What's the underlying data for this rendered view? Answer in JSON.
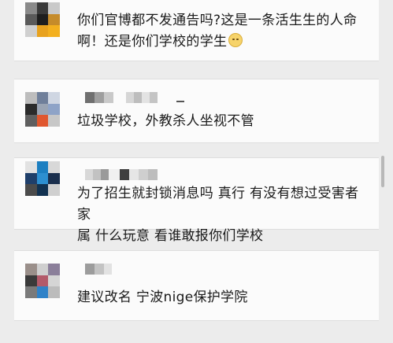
{
  "comments": [
    {
      "text_line1": "你们官博都不发通告吗?这是一条活生生的人命",
      "text_line2": "啊！还是你们学校的学生",
      "emoji": "slightly-frowning-emoji"
    },
    {
      "text": "垃圾学校，外教杀人坐视不管"
    },
    {
      "text_line1": "为了招生就封锁消息吗 真行 有没有想过受害者家",
      "text_line2": "属 什么玩意 看谁敢报你们学校"
    },
    {
      "text": "建议改名  宁波nige保护学院"
    }
  ]
}
